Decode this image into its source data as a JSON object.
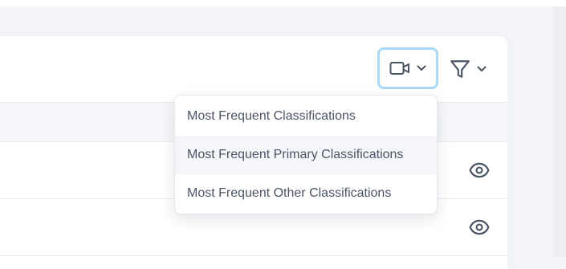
{
  "toolbar": {
    "video_icon": "video-camera-icon",
    "video_caret": "chevron-down-icon",
    "filter_icon": "filter-funnel-icon",
    "filter_caret": "chevron-down-icon"
  },
  "dropdown": {
    "items": [
      {
        "label": "Most Frequent Classifications"
      },
      {
        "label": "Most Frequent Primary Classifications"
      },
      {
        "label": "Most Frequent Other Classifications"
      }
    ],
    "hovered_index": 1
  },
  "table": {
    "rows": [
      {
        "action_icon": "eye-icon"
      },
      {
        "action_icon": "eye-icon"
      }
    ]
  },
  "colors": {
    "focus_ring": "#a9d9f3",
    "icon": "#4b5563",
    "menu_text": "#4b5563",
    "page_bg": "#f2f4f8"
  }
}
